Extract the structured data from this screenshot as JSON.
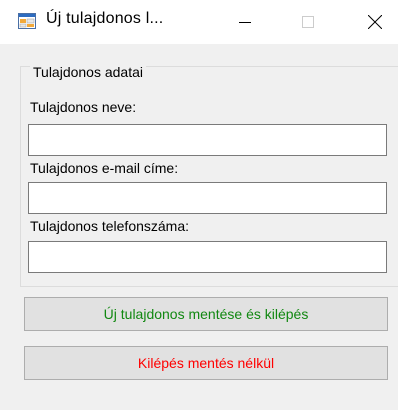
{
  "window": {
    "title": "Új tulajdonos l...",
    "icon": "form-app-icon",
    "controls": {
      "minimize": "minimize-icon",
      "maximize": "maximize-icon",
      "close": "close-icon"
    }
  },
  "group": {
    "legend": "Tulajdonos adatai",
    "fields": [
      {
        "label": "Tulajdonos neve:",
        "value": ""
      },
      {
        "label": "Tulajdonos e-mail címe:",
        "value": ""
      },
      {
        "label": "Tulajdonos telefonszáma:",
        "value": ""
      }
    ]
  },
  "buttons": {
    "save_label": "Új tulajdonos mentése és kilépés",
    "save_color": "#118811",
    "exit_label": "Kilépés mentés nélkül",
    "exit_color": "#ff0000"
  }
}
